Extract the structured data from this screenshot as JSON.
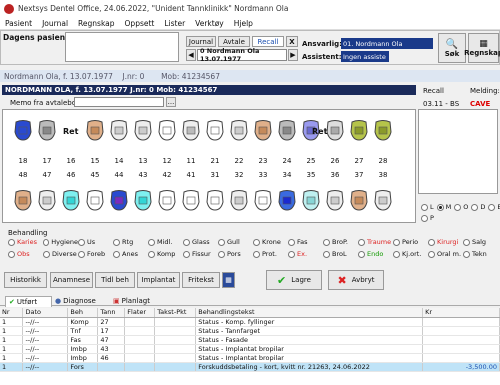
{
  "app": {
    "title": "Nextsys Dentel Office,  24.06.2022, \"Unident Tannklinikk\"  Nordmann Ola"
  },
  "menu": [
    "Pasient",
    "Journal",
    "Regnskap",
    "Oppsett",
    "Lister",
    "Verktøy",
    "Hjelp"
  ],
  "top": {
    "dagens_label": "Dagens pasienter:",
    "tabs": [
      "Journal",
      "Avtale",
      "Recall"
    ],
    "close": "X",
    "patient_selected": "0 Nordmann Ola 13.07.1977",
    "ansvarlig_label": "Ansvarlig:",
    "ansvarlig_value": "01. Nordmann Ola",
    "assistent_label": "Assistent:",
    "assistent_value": "Ingen assiste",
    "sok": "Søk",
    "regnskap": "Regnskap"
  },
  "patient": {
    "bar": "Nordmann Ola, f. 13.07.1977    J.nr: 0       Mob: 41234567",
    "header": "NORDMANN OLA, f. 13.07.1977  J.nr: 0  Mob: 41234567",
    "recall_label": "Recall",
    "recall_value": "03.11 - BS",
    "melding_label": "Melding:",
    "cave": "CAVE",
    "memo_label": "Memo fra avtalebok:",
    "memo_btn": "..."
  },
  "teeth": {
    "upper": [
      "18",
      "17",
      "16",
      "15",
      "14",
      "13",
      "12",
      "11",
      "21",
      "22",
      "23",
      "24",
      "25",
      "26",
      "27",
      "28"
    ],
    "lower": [
      "48",
      "47",
      "46",
      "45",
      "44",
      "43",
      "42",
      "41",
      "31",
      "32",
      "33",
      "34",
      "35",
      "36",
      "37",
      "38"
    ],
    "ret_label": "Ret"
  },
  "surface_options": [
    "L",
    "M",
    "O",
    "D",
    "B",
    "P"
  ],
  "behandling": {
    "label": "Behandling",
    "options": [
      "Karies",
      "Hygiene",
      "Us",
      "Rtg",
      "Midl.",
      "Glass",
      "Gull",
      "Krone",
      "Fas",
      "BroP.",
      "Traume",
      "Perio",
      "Kirurgi",
      "Salg",
      "Obs",
      "Diverse",
      "Foreb",
      "Anes",
      "Komp",
      "Fissur",
      "Pors",
      "Prot.",
      "Ex.",
      "BroL",
      "Endo",
      "Kj.ort.",
      "Oral m.",
      "Tekn"
    ]
  },
  "buttons": {
    "historikk": "Historikk",
    "anamnese": "Anamnese",
    "tidl": "Tidl beh",
    "implantat": "Implantat",
    "fritekst": "Fritekst",
    "lagre": "Lagre",
    "avbryt": "Avbryt"
  },
  "tabs": [
    "Utført",
    "Diagnose",
    "Planlagt"
  ],
  "table": {
    "headers": [
      "Nr",
      "Dato",
      "Beh",
      "Tann",
      "Flater",
      "Takst-Pkt",
      "Behandlingstekst",
      "Kr"
    ],
    "rows": [
      [
        "1",
        "--//--",
        "Komp",
        "27",
        "",
        "",
        "Status - Komp. fyllinger",
        ""
      ],
      [
        "1",
        "--//--",
        "Tnf",
        "17",
        "",
        "",
        "Status - Tannfarget",
        ""
      ],
      [
        "1",
        "--//--",
        "Fas",
        "47",
        "",
        "",
        "Status - Fasade",
        ""
      ],
      [
        "1",
        "--//--",
        "Imbp",
        "43",
        "",
        "",
        "Status - Implantat bropilar",
        ""
      ],
      [
        "1",
        "--//--",
        "Imbp",
        "46",
        "",
        "",
        "Status - Implantat bropilar",
        ""
      ],
      [
        "1",
        "--//--",
        "Fors",
        "",
        "",
        "",
        "Forskuddsbetaling - kort, kvitt nr. 21263, 24.06.2022",
        "-3,500.00"
      ]
    ]
  }
}
